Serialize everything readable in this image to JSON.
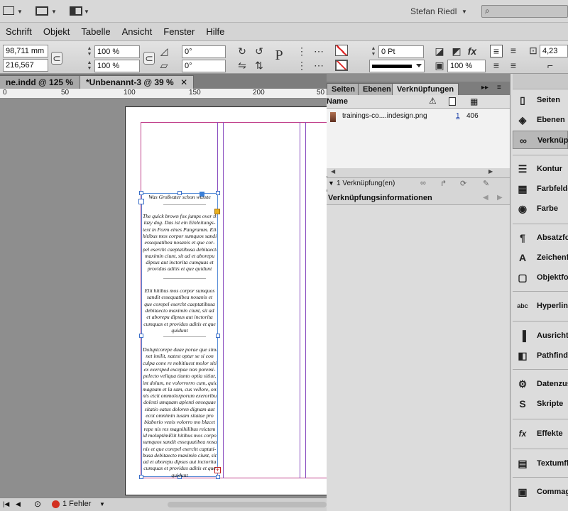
{
  "app": {
    "user": "Stefan Riedl",
    "search_placeholder": ""
  },
  "menu": [
    "Schrift",
    "Objekt",
    "Tabelle",
    "Ansicht",
    "Fenster",
    "Hilfe"
  ],
  "control": {
    "x": "98,711 mm",
    "y": "216,567 mm",
    "scale_x": "100 %",
    "scale_y": "100 %",
    "angle": "0°",
    "shear": "0°",
    "stroke_weight": "0 Pt",
    "opacity": "100 %",
    "offset": "4,23"
  },
  "doc_tabs": [
    "ne.indd @ 125 %",
    "*Unbenannt-3 @ 39 %"
  ],
  "ruler": [
    "0",
    "50",
    "100",
    "150",
    "200",
    "50"
  ],
  "text_lines": [
    "Was Großvater schon wusste",
    "The quick brown fox jumps over the",
    "lazy dog. Das ist ein Einleitungs-",
    "text in Form eines Pangramm. Elit",
    "hitibus mos corpor sumquos sandit",
    "essequatibea nosanis et que cor-",
    "pel esercht caeptatibusa debitaecto",
    "maximin ciunt, sit ad et aborepu",
    "dipsus aut inctorita cumquas et",
    "providus aditis et que quidunt",
    "Elit hitibus mos corpor sumquos",
    "sandit essequatibea nosanis et",
    "que corepel esercht caeptatibusa",
    "debitaecto maximin ciunt, sit ad",
    "et aborepu dipsus aut inctorita",
    "cumquas et providus aditis et que",
    "quidunt",
    "Doluptcorepe duae porae que simi,",
    "net imilit, natest optur se si con",
    "culpa cone re nobitiuest molor sitis",
    "ex exersped excepae non poremi-",
    "pelecto veliqua tiunto optia sitiur,",
    "int dolum, ne volorrorro cum, quid",
    "magnam et la sam, cus vellore, om-",
    "nis etcit ommolorporum exeroribus",
    "dolesti umquam apienti onsequae",
    "sitatio eatus doloren dignam aut",
    "ecot omnimin iusam sitatae pro",
    "blaborio venis volorro mo blacet",
    "repe nis res magnihilibus reictem",
    "id moluptimElit hitibus mos corpor",
    "sumquos sandit essequatibea nosa-",
    "nis et que corepel esercht captati-",
    "busa debitaecto maximin ciunt, sit",
    "ad et aborepu dipsus aut inctorita",
    "cumquas et providus aditis et que",
    "quidunt"
  ],
  "panel": {
    "tabs": [
      "Seiten",
      "Ebenen",
      "Verknüpfungen"
    ],
    "col_name": "Name",
    "link": {
      "name": "trainings-co....indesign.png",
      "page": "1",
      "size": "406"
    },
    "status": "1 Verknüpfung(en)",
    "info_title": "Verknüpfungsinformationen"
  },
  "dock": [
    {
      "label": "Seiten",
      "icon": "pages-icon",
      "glyph": "▯"
    },
    {
      "label": "Ebenen",
      "icon": "layers-icon",
      "glyph": "◈"
    },
    {
      "label": "Verknüpf",
      "icon": "links-icon",
      "glyph": "∞"
    },
    {
      "label": "Kontur",
      "icon": "stroke-icon",
      "glyph": "☰"
    },
    {
      "label": "Farbfelde",
      "icon": "swatches-icon",
      "glyph": "▦"
    },
    {
      "label": "Farbe",
      "icon": "color-icon",
      "glyph": "◉"
    },
    {
      "label": "Absatzfo",
      "icon": "paragraph-styles-icon",
      "glyph": "¶"
    },
    {
      "label": "Zeichenfo",
      "icon": "character-styles-icon",
      "glyph": "A"
    },
    {
      "label": "Objektfo",
      "icon": "object-styles-icon",
      "glyph": "▢"
    },
    {
      "label": "Hyperlink",
      "icon": "hyperlinks-icon",
      "glyph": "abc"
    },
    {
      "label": "Ausricht",
      "icon": "align-icon",
      "glyph": "▐"
    },
    {
      "label": "Pathfinde",
      "icon": "pathfinder-icon",
      "glyph": "◧"
    },
    {
      "label": "Datenzus",
      "icon": "data-merge-icon",
      "glyph": "⚙"
    },
    {
      "label": "Skripte",
      "icon": "scripts-icon",
      "glyph": "S"
    },
    {
      "label": "Effekte",
      "icon": "effects-icon",
      "glyph": "fx"
    },
    {
      "label": "Textumfl",
      "icon": "text-wrap-icon",
      "glyph": "▤"
    },
    {
      "label": "Commag",
      "icon": "command-icon",
      "glyph": "▣"
    }
  ],
  "status": {
    "errors": "1 Fehler"
  }
}
